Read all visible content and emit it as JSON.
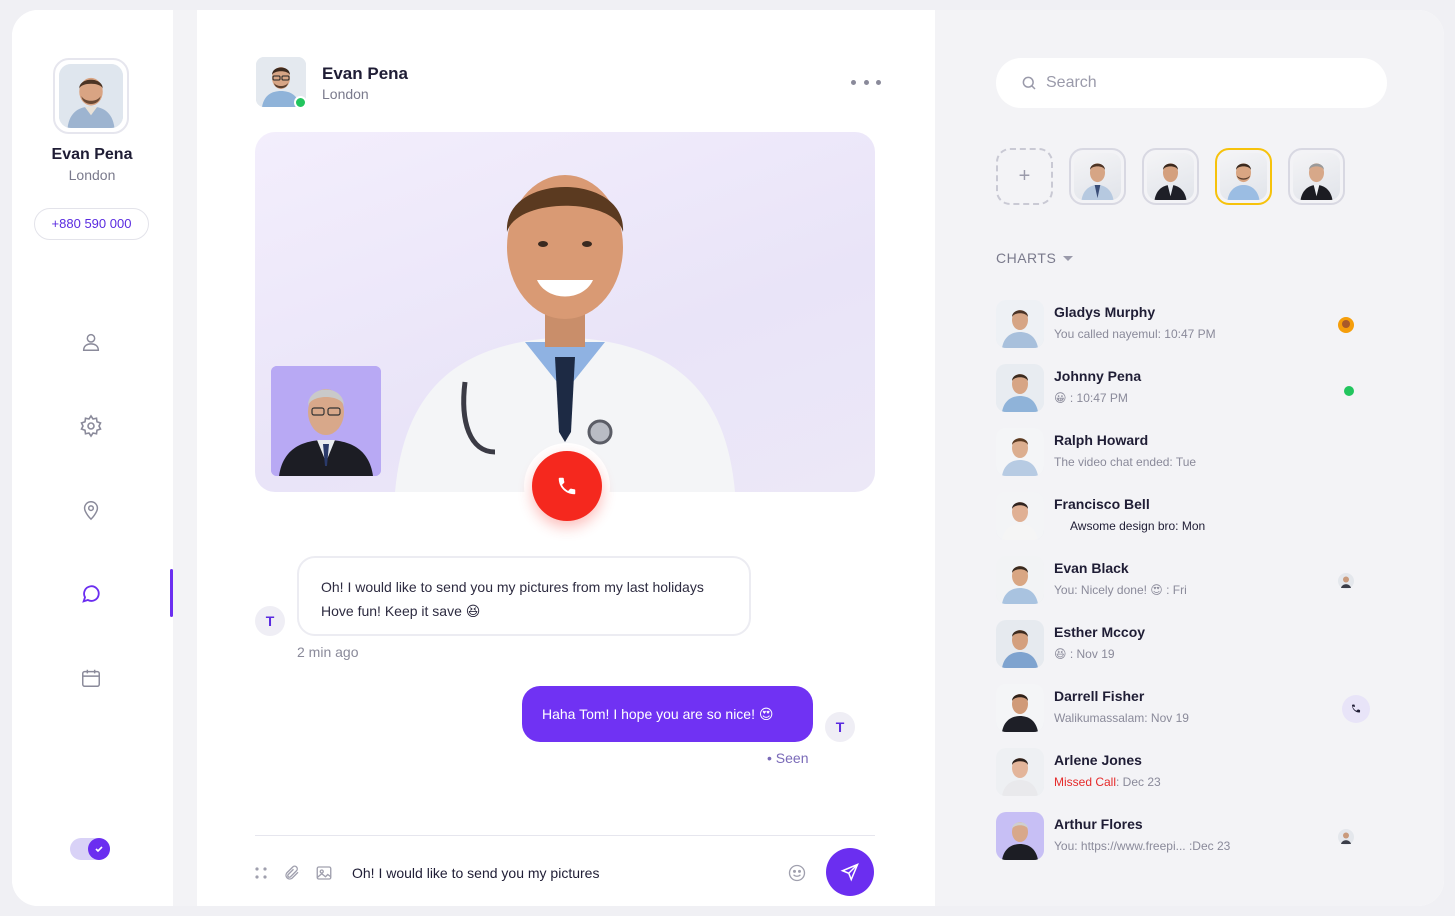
{
  "colors": {
    "accent": "#6b2ef0",
    "end_call": "#f5281e",
    "online": "#22c55e",
    "missed": "#e52a2a",
    "story_active": "#f6c20c"
  },
  "profile": {
    "name": "Evan Pena",
    "city": "London",
    "phone": "+880 590 000"
  },
  "nav": {
    "items": [
      "user-icon",
      "gear-icon",
      "location-pin-icon",
      "chat-bubble-icon",
      "calendar-icon"
    ],
    "active": "chat-bubble-icon"
  },
  "theme_toggle": {
    "on": true
  },
  "chat": {
    "header": {
      "name": "Evan Pena",
      "city": "London",
      "online": true
    },
    "messages": [
      {
        "from": "T",
        "lines": [
          "Oh! I would like to send you my pictures from my last holidays",
          "Hove fun! Keep it save"
        ],
        "emoji": "😆",
        "time": "2 min ago"
      },
      {
        "from": "T",
        "text": "Haha Tom! I hope you are so nice!",
        "emoji": "😍",
        "status": "Seen"
      }
    ],
    "input": {
      "value": "Oh! I would like to send you my pictures"
    }
  },
  "right": {
    "search": {
      "placeholder": "Search"
    },
    "section_label": "CHARTS",
    "contacts": [
      {
        "name": "Gladys Murphy",
        "preview": "You called nayemul: 10:47 PM",
        "status": "emoji"
      },
      {
        "name": "Johnny Pena",
        "preview_emoji": "😀",
        "preview": " : 10:47 PM",
        "status": "online"
      },
      {
        "name": "Ralph Howard",
        "preview": "The video chat ended: Tue",
        "status": ""
      },
      {
        "name": "Francisco Bell",
        "preview": "Awsome design bro: Mon",
        "status": ""
      },
      {
        "name": "Evan Black",
        "preview": "You: Nicely done! 😍 : Fri",
        "status": "avatar"
      },
      {
        "name": "Esther Mccoy",
        "preview_emoji": "😆",
        "preview": " : Nov 19",
        "status": ""
      },
      {
        "name": "Darrell Fisher",
        "preview": "Walikumassalam: Nov 19",
        "status": "call"
      },
      {
        "name": "Arlene Jones",
        "missed": "Missed Call",
        "preview": ": Dec 23",
        "status": ""
      },
      {
        "name": "Arthur Flores",
        "preview": "You: https://www.freepi...  :Dec 23",
        "status": "avatar"
      }
    ]
  }
}
